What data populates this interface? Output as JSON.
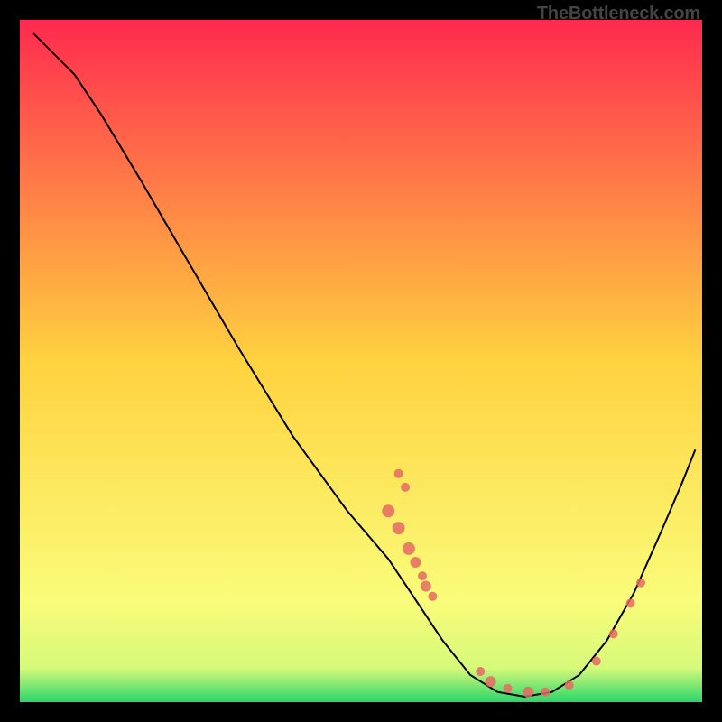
{
  "watermark": "TheBottleneck.com",
  "chart_data": {
    "type": "line",
    "title": "",
    "xlabel": "",
    "ylabel": "",
    "xlim": [
      0,
      100
    ],
    "ylim": [
      0,
      100
    ],
    "gradient_stops": [
      {
        "offset": 0.0,
        "color": "#ff2a4f"
      },
      {
        "offset": 0.5,
        "color": "#ffd23f"
      },
      {
        "offset": 0.85,
        "color": "#fafc7a"
      },
      {
        "offset": 0.95,
        "color": "#d7f97a"
      },
      {
        "offset": 1.0,
        "color": "#2bd66b"
      }
    ],
    "curve": [
      {
        "x": 2,
        "y": 98
      },
      {
        "x": 5,
        "y": 95
      },
      {
        "x": 8,
        "y": 92
      },
      {
        "x": 12,
        "y": 86
      },
      {
        "x": 18,
        "y": 76
      },
      {
        "x": 25,
        "y": 64
      },
      {
        "x": 32,
        "y": 52
      },
      {
        "x": 40,
        "y": 39
      },
      {
        "x": 48,
        "y": 28
      },
      {
        "x": 54,
        "y": 21
      },
      {
        "x": 58,
        "y": 15
      },
      {
        "x": 62,
        "y": 9
      },
      {
        "x": 66,
        "y": 4
      },
      {
        "x": 70,
        "y": 1.5
      },
      {
        "x": 74,
        "y": 0.8
      },
      {
        "x": 78,
        "y": 1.5
      },
      {
        "x": 82,
        "y": 4
      },
      {
        "x": 86,
        "y": 9
      },
      {
        "x": 90,
        "y": 16
      },
      {
        "x": 94,
        "y": 25
      },
      {
        "x": 97,
        "y": 32
      },
      {
        "x": 99,
        "y": 37
      }
    ],
    "scatter_points": [
      {
        "x": 55.5,
        "y": 33.5,
        "r": 5
      },
      {
        "x": 56.5,
        "y": 31.5,
        "r": 5
      },
      {
        "x": 54.0,
        "y": 28.0,
        "r": 7
      },
      {
        "x": 55.5,
        "y": 25.5,
        "r": 7
      },
      {
        "x": 57.0,
        "y": 22.5,
        "r": 7
      },
      {
        "x": 58.0,
        "y": 20.5,
        "r": 6
      },
      {
        "x": 59.0,
        "y": 18.5,
        "r": 5
      },
      {
        "x": 59.5,
        "y": 17.0,
        "r": 6
      },
      {
        "x": 60.5,
        "y": 15.5,
        "r": 5
      },
      {
        "x": 67.5,
        "y": 4.5,
        "r": 5
      },
      {
        "x": 69.0,
        "y": 3.0,
        "r": 6
      },
      {
        "x": 71.5,
        "y": 2.0,
        "r": 5
      },
      {
        "x": 74.5,
        "y": 1.5,
        "r": 6
      },
      {
        "x": 77.0,
        "y": 1.5,
        "r": 5
      },
      {
        "x": 80.5,
        "y": 2.5,
        "r": 5
      },
      {
        "x": 84.5,
        "y": 6.0,
        "r": 5
      },
      {
        "x": 87.0,
        "y": 10.0,
        "r": 5
      },
      {
        "x": 89.5,
        "y": 14.5,
        "r": 5
      },
      {
        "x": 91.0,
        "y": 17.5,
        "r": 5
      }
    ],
    "point_color": "#e46a63"
  }
}
